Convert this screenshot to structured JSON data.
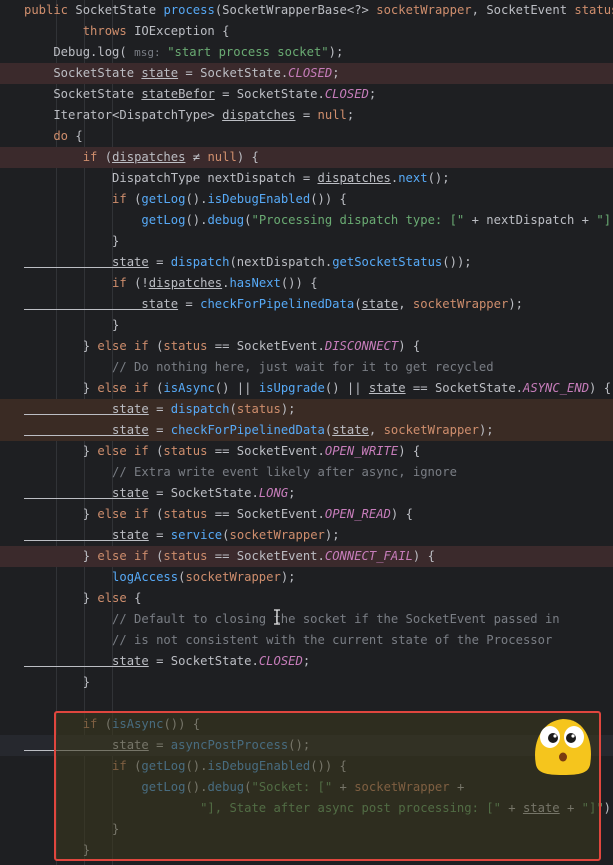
{
  "code": {
    "lines": [
      {
        "id": "l1",
        "segments": [
          [
            "kw",
            "public "
          ],
          [
            "ty",
            "SocketState "
          ],
          [
            "fn",
            "process"
          ],
          [
            "pm",
            "(SocketWrapperBase<?> "
          ],
          [
            "kw",
            "socketWrapper"
          ],
          [
            "pm",
            ", SocketEvent "
          ],
          [
            "kw",
            "status"
          ],
          [
            "pm",
            ")"
          ]
        ]
      },
      {
        "id": "l2",
        "segments": [
          [
            "kw",
            "        throws "
          ],
          [
            "ty",
            "IOException {"
          ]
        ]
      },
      {
        "id": "l3",
        "segments": [
          [
            "ty",
            "    Debug."
          ],
          [
            "var",
            "log"
          ],
          [
            "pm",
            "( "
          ],
          [
            "hint",
            "msg: "
          ],
          [
            "str",
            "\"start process socket\""
          ],
          [
            "pm",
            ");"
          ]
        ]
      },
      {
        "id": "l4",
        "segments": [
          [
            "ty",
            "    SocketState "
          ],
          [
            "ul",
            "state"
          ],
          [
            "pm",
            " = SocketState."
          ],
          [
            "cn",
            "CLOSED"
          ],
          [
            "pm",
            ";"
          ]
        ]
      },
      {
        "id": "l5",
        "segments": [
          [
            "ty",
            "    SocketState "
          ],
          [
            "ul",
            "stateBefor"
          ],
          [
            "pm",
            " = SocketState."
          ],
          [
            "cn",
            "CLOSED"
          ],
          [
            "pm",
            ";"
          ]
        ]
      },
      {
        "id": "l6",
        "segments": [
          [
            "ty",
            "    Iterator<DispatchType> "
          ],
          [
            "ul",
            "dispatches"
          ],
          [
            "pm",
            " = "
          ],
          [
            "kw",
            "null"
          ],
          [
            "pm",
            ";"
          ]
        ]
      },
      {
        "id": "l7",
        "segments": [
          [
            "kw",
            "    do "
          ],
          [
            "pm",
            "{"
          ]
        ]
      },
      {
        "id": "l8",
        "segments": [
          [
            "kw",
            "        if "
          ],
          [
            "pm",
            "("
          ],
          [
            "ul",
            "dispatches"
          ],
          [
            "pm",
            " ≠ "
          ],
          [
            "kw",
            "null"
          ],
          [
            "pm",
            ") {"
          ]
        ]
      },
      {
        "id": "l9",
        "segments": [
          [
            "ty",
            "            DispatchType nextDispatch = "
          ],
          [
            "ul",
            "dispatches"
          ],
          [
            "pm",
            "."
          ],
          [
            "mf",
            "next"
          ],
          [
            "pm",
            "();"
          ]
        ]
      },
      {
        "id": "l10",
        "segments": [
          [
            "kw",
            "            if "
          ],
          [
            "pm",
            "("
          ],
          [
            "mf",
            "getLog"
          ],
          [
            "pm",
            "()."
          ],
          [
            "mf",
            "isDebugEnabled"
          ],
          [
            "pm",
            "()) {"
          ]
        ]
      },
      {
        "id": "l11",
        "segments": [
          [
            "mf",
            "                getLog"
          ],
          [
            "pm",
            "()."
          ],
          [
            "mf",
            "debug"
          ],
          [
            "pm",
            "("
          ],
          [
            "str",
            "\"Processing dispatch type: [\""
          ],
          [
            "pm",
            " + nextDispatch + "
          ],
          [
            "str",
            "\"]\""
          ],
          [
            "pm",
            ");"
          ]
        ]
      },
      {
        "id": "l12",
        "segments": [
          [
            "pm",
            "            }"
          ]
        ]
      },
      {
        "id": "l13",
        "segments": [
          [
            "ul",
            "            state"
          ],
          [
            "pm",
            " = "
          ],
          [
            "mf",
            "dispatch"
          ],
          [
            "pm",
            "(nextDispatch."
          ],
          [
            "mf",
            "getSocketStatus"
          ],
          [
            "pm",
            "());"
          ]
        ]
      },
      {
        "id": "l14",
        "segments": [
          [
            "kw",
            "            if "
          ],
          [
            "pm",
            "(!"
          ],
          [
            "ul",
            "dispatches"
          ],
          [
            "pm",
            "."
          ],
          [
            "mf",
            "hasNext"
          ],
          [
            "pm",
            "()) {"
          ]
        ]
      },
      {
        "id": "l15",
        "segments": [
          [
            "ul",
            "                state"
          ],
          [
            "pm",
            " = "
          ],
          [
            "mf",
            "checkForPipelinedData"
          ],
          [
            "pm",
            "("
          ],
          [
            "ul",
            "state"
          ],
          [
            "pm",
            ", "
          ],
          [
            "kw",
            "socketWrapper"
          ],
          [
            "pm",
            ");"
          ]
        ]
      },
      {
        "id": "l16",
        "segments": [
          [
            "pm",
            "            }"
          ]
        ]
      },
      {
        "id": "l17",
        "segments": [
          [
            "pm",
            "        } "
          ],
          [
            "kw",
            "else if "
          ],
          [
            "pm",
            "("
          ],
          [
            "kw",
            "status"
          ],
          [
            "pm",
            " == SocketEvent."
          ],
          [
            "cn",
            "DISCONNECT"
          ],
          [
            "pm",
            ") {"
          ]
        ]
      },
      {
        "id": "l18",
        "segments": [
          [
            "cm",
            "            // Do nothing here, just wait for it to get recycled"
          ]
        ]
      },
      {
        "id": "l19",
        "segments": [
          [
            "pm",
            "        } "
          ],
          [
            "kw",
            "else if "
          ],
          [
            "pm",
            "("
          ],
          [
            "mf",
            "isAsync"
          ],
          [
            "pm",
            "() || "
          ],
          [
            "mf",
            "isUpgrade"
          ],
          [
            "pm",
            "() || "
          ],
          [
            "ul",
            "state"
          ],
          [
            "pm",
            " == SocketState."
          ],
          [
            "cn",
            "ASYNC_END"
          ],
          [
            "pm",
            ") {"
          ]
        ]
      },
      {
        "id": "l20",
        "segments": [
          [
            "ul",
            "            state"
          ],
          [
            "pm",
            " = "
          ],
          [
            "mf",
            "dispatch"
          ],
          [
            "pm",
            "("
          ],
          [
            "kw",
            "status"
          ],
          [
            "pm",
            ");"
          ]
        ]
      },
      {
        "id": "l21",
        "segments": [
          [
            "ul",
            "            state"
          ],
          [
            "pm",
            " = "
          ],
          [
            "mf",
            "checkForPipelinedData"
          ],
          [
            "pm",
            "("
          ],
          [
            "ul",
            "state"
          ],
          [
            "pm",
            ", "
          ],
          [
            "kw",
            "socketWrapper"
          ],
          [
            "pm",
            ");"
          ]
        ]
      },
      {
        "id": "l22",
        "segments": [
          [
            "pm",
            "        } "
          ],
          [
            "kw",
            "else if "
          ],
          [
            "pm",
            "("
          ],
          [
            "kw",
            "status"
          ],
          [
            "pm",
            " == SocketEvent."
          ],
          [
            "cn",
            "OPEN_WRITE"
          ],
          [
            "pm",
            ") {"
          ]
        ]
      },
      {
        "id": "l23",
        "segments": [
          [
            "cm",
            "            // Extra write event likely after async, ignore"
          ]
        ]
      },
      {
        "id": "l24",
        "segments": [
          [
            "ul",
            "            state"
          ],
          [
            "pm",
            " = SocketState."
          ],
          [
            "cn",
            "LONG"
          ],
          [
            "pm",
            ";"
          ]
        ]
      },
      {
        "id": "l25",
        "segments": [
          [
            "pm",
            "        } "
          ],
          [
            "kw",
            "else if "
          ],
          [
            "pm",
            "("
          ],
          [
            "kw",
            "status"
          ],
          [
            "pm",
            " == SocketEvent."
          ],
          [
            "cn",
            "OPEN_READ"
          ],
          [
            "pm",
            ") {"
          ]
        ]
      },
      {
        "id": "l26",
        "segments": [
          [
            "ul",
            "            state"
          ],
          [
            "pm",
            " = "
          ],
          [
            "mf",
            "service"
          ],
          [
            "pm",
            "("
          ],
          [
            "kw",
            "socketWrapper"
          ],
          [
            "pm",
            ");"
          ]
        ]
      },
      {
        "id": "l27",
        "segments": [
          [
            "pm",
            "        } "
          ],
          [
            "kw",
            "else if "
          ],
          [
            "pm",
            "("
          ],
          [
            "kw",
            "status"
          ],
          [
            "pm",
            " == SocketEvent."
          ],
          [
            "cn",
            "CONNECT_FAIL"
          ],
          [
            "pm",
            ") {"
          ]
        ]
      },
      {
        "id": "l28",
        "segments": [
          [
            "mf",
            "            logAccess"
          ],
          [
            "pm",
            "("
          ],
          [
            "kw",
            "socketWrapper"
          ],
          [
            "pm",
            ");"
          ]
        ]
      },
      {
        "id": "l29",
        "segments": [
          [
            "pm",
            "        } "
          ],
          [
            "kw",
            "else "
          ],
          [
            "pm",
            "{"
          ]
        ]
      },
      {
        "id": "l30",
        "segments": [
          [
            "cm",
            "            // Default to closing the socket if the SocketEvent passed in"
          ]
        ]
      },
      {
        "id": "l31",
        "segments": [
          [
            "cm",
            "            // is not consistent with the current state of the Processor"
          ]
        ]
      },
      {
        "id": "l32",
        "segments": [
          [
            "ul",
            "            state"
          ],
          [
            "pm",
            " = SocketState."
          ],
          [
            "cn",
            "CLOSED"
          ],
          [
            "pm",
            ";"
          ]
        ]
      },
      {
        "id": "l33",
        "segments": [
          [
            "pm",
            "        }"
          ]
        ]
      },
      {
        "id": "l34",
        "segments": []
      },
      {
        "id": "l35",
        "segments": [
          [
            "kw",
            "        if "
          ],
          [
            "pm",
            "("
          ],
          [
            "mf",
            "isAsync"
          ],
          [
            "pm",
            "()) {"
          ]
        ]
      },
      {
        "id": "l36",
        "segments": [
          [
            "ul",
            "            state"
          ],
          [
            "pm",
            " = "
          ],
          [
            "mf",
            "asyncPostProcess"
          ],
          [
            "pm",
            "();"
          ]
        ]
      },
      {
        "id": "l37",
        "segments": [
          [
            "kw",
            "            if "
          ],
          [
            "pm",
            "("
          ],
          [
            "mf",
            "getLog"
          ],
          [
            "pm",
            "()."
          ],
          [
            "mf",
            "isDebugEnabled"
          ],
          [
            "pm",
            "()) {"
          ]
        ]
      },
      {
        "id": "l38",
        "segments": [
          [
            "mf",
            "                getLog"
          ],
          [
            "pm",
            "()."
          ],
          [
            "mf",
            "debug"
          ],
          [
            "pm",
            "("
          ],
          [
            "str",
            "\"Socket: [\""
          ],
          [
            "pm",
            " + "
          ],
          [
            "kw",
            "socketWrapper"
          ],
          [
            "pm",
            " +"
          ]
        ]
      },
      {
        "id": "l39",
        "segments": [
          [
            "str",
            "                        \"], State after async post processing: [\""
          ],
          [
            "pm",
            " + "
          ],
          [
            "ul",
            "state"
          ],
          [
            "pm",
            " + "
          ],
          [
            "str",
            "\"]\""
          ],
          [
            "pm",
            ");"
          ]
        ]
      },
      {
        "id": "l40",
        "segments": [
          [
            "pm",
            "            }"
          ]
        ]
      },
      {
        "id": "l41",
        "segments": [
          [
            "pm",
            "        }"
          ]
        ]
      }
    ]
  },
  "colors": {
    "background": "#1e1f22",
    "keyword": "#cf8e6d",
    "method": "#56a8f5",
    "string": "#6aab73",
    "constant": "#c77dbb",
    "comment": "#7a7e85",
    "highlight_box": "#e0463e"
  },
  "overlay": {
    "emoji_icon": "shocked-face-emoji-icon",
    "cursor_icon": "text-cursor-icon"
  }
}
